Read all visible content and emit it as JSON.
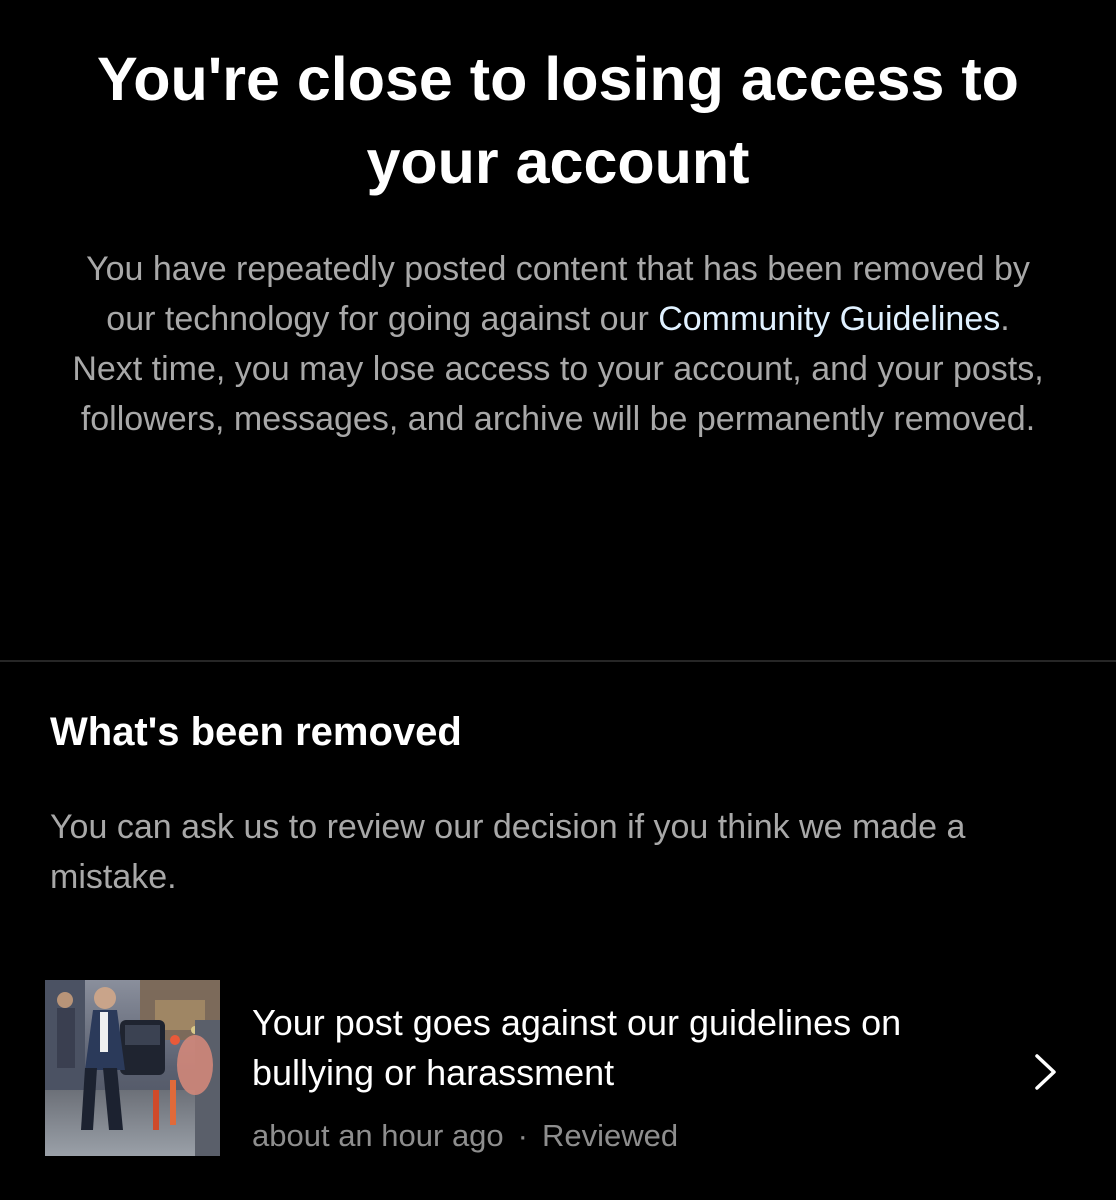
{
  "header": {
    "title": "You're close to losing access to your account",
    "body_before": "You have repeatedly posted content that has been removed by our technology for going against our ",
    "link_label": "Community Guidelines",
    "body_after": ". Next time, you may lose access to your account, and your posts, followers, messages, and archive will be permanently removed."
  },
  "removed": {
    "heading": "What's been removed",
    "subtitle": "You can ask us to review our decision if you think we made a mistake.",
    "items": [
      {
        "title": "Your post goes against our guidelines on bullying or harassment",
        "time": "about an hour ago",
        "separator": "·",
        "status": "Reviewed",
        "thumbnail_icon": "post-thumbnail"
      }
    ],
    "chevron_icon": "chevron-right-icon"
  },
  "colors": {
    "background": "#000000",
    "primary_text": "#ffffff",
    "secondary_text": "#a8a8a8",
    "link": "#e0f1ff",
    "divider": "#262626"
  }
}
